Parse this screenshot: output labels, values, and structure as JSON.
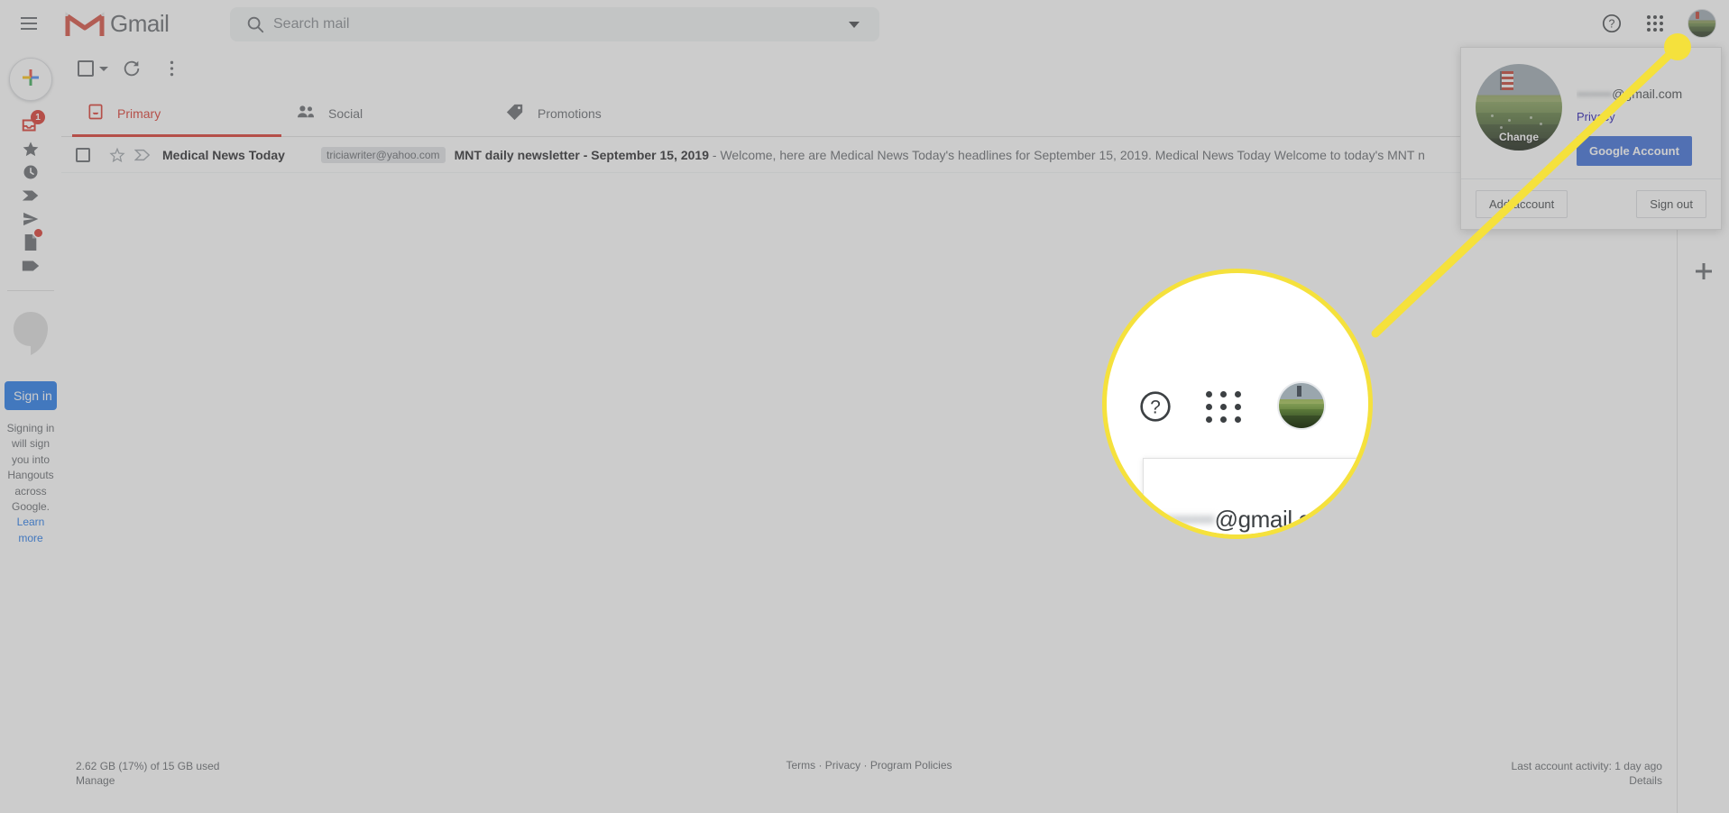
{
  "app": {
    "title": "Gmail",
    "brand_color": "#d93025"
  },
  "header": {
    "menu_icon": "hamburger-icon",
    "logo_icon": "gmail-m-logo",
    "brand_label": "Gmail",
    "search": {
      "icon": "search-icon",
      "placeholder": "Search mail",
      "value": "",
      "options_icon": "chevron-down-icon"
    },
    "help_icon": "help-question-icon",
    "apps_icon": "google-apps-grid-icon",
    "avatar_icon": "account-avatar"
  },
  "rail": {
    "compose_icon": "compose-plus-icon",
    "items": [
      {
        "name": "inbox",
        "icon": "inbox-icon",
        "badge": "1"
      },
      {
        "name": "starred",
        "icon": "star-icon",
        "badge": ""
      },
      {
        "name": "snoozed",
        "icon": "clock-icon",
        "badge": ""
      },
      {
        "name": "important",
        "icon": "important-chevron-icon",
        "badge": ""
      },
      {
        "name": "sent",
        "icon": "send-arrow-icon",
        "badge": ""
      },
      {
        "name": "drafts",
        "icon": "drafts-file-icon",
        "badge": "dot"
      },
      {
        "name": "labels",
        "icon": "label-tag-icon",
        "badge": ""
      }
    ],
    "hangouts": {
      "logo_icon": "hangouts-logo-icon",
      "signin_button": "Sign in",
      "note": "Signing in will sign you into Hangouts across Google.",
      "learn_more": "Learn more"
    }
  },
  "toolbar": {
    "select_all_icon": "checkbox-icon",
    "select_all_caret_icon": "chevron-down-icon",
    "refresh_icon": "refresh-icon",
    "more_icon": "more-vertical-icon"
  },
  "tabs": [
    {
      "label": "Primary",
      "icon": "inbox-tab-icon",
      "active": true
    },
    {
      "label": "Social",
      "icon": "people-icon",
      "active": false
    },
    {
      "label": "Promotions",
      "icon": "price-tag-icon",
      "active": false
    }
  ],
  "threads": [
    {
      "checkbox_icon": "checkbox-icon",
      "star_icon": "star-outline-icon",
      "important_icon": "important-marker-icon",
      "sender": "Medical News Today",
      "chip": "triciawriter@yahoo.com",
      "subject": "MNT daily newsletter - September 15, 2019",
      "snippet": " - Welcome, here are Medical News Today's headlines for September 15, 2019. Medical News Today Welcome to today's MNT n"
    }
  ],
  "footer": {
    "storage": "2.62 GB (17%) of 15 GB used",
    "manage": "Manage",
    "terms": "Terms",
    "privacy": "Privacy",
    "program_policies": "Program Policies",
    "separator": "·",
    "activity": "Last account activity: 1 day ago",
    "details": "Details"
  },
  "addon_rail": {
    "add_icon": "plus-icon"
  },
  "account_popup": {
    "photo_icon": "profile-photo",
    "change_label": "Change",
    "name": "",
    "email_redacted": "••••••••",
    "email_domain": "@gmail.com",
    "privacy_link": "Privacy",
    "google_account_button": "Google Account",
    "add_account_button": "Add account",
    "sign_out_button": "Sign out"
  },
  "callout": {
    "line_color": "#f5e13c",
    "dot_color": "#f5e13c",
    "magnifier_border_color": "#f5e13c",
    "magnified_email_domain": "@gmail.com",
    "magnified_help_icon": "help-question-icon",
    "magnified_apps_icon": "google-apps-grid-icon",
    "magnified_avatar_icon": "account-avatar"
  }
}
